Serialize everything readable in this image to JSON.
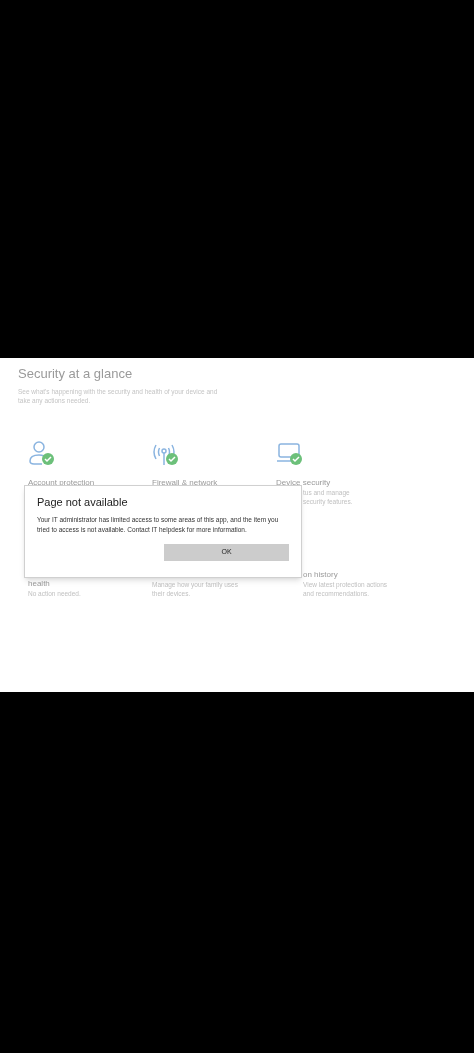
{
  "page": {
    "title": "Security at a glance",
    "subtitle": "See what's happening with the security and health of your device and take any actions needed."
  },
  "tiles": [
    {
      "kind": "person",
      "title": "Account protection"
    },
    {
      "kind": "antenna",
      "title": "Firewall & network"
    },
    {
      "kind": "laptop",
      "title": "Device security",
      "description_lines": [
        "tus and manage",
        "security features."
      ]
    }
  ],
  "tiles_row_2": [
    {
      "title": "health",
      "description_lines": [
        "No action needed."
      ]
    },
    {
      "description_lines": [
        "Manage how your family uses",
        "their devices."
      ]
    },
    {
      "title": "on history",
      "description_lines": [
        "View latest protection actions",
        "and recommendations."
      ]
    }
  ],
  "dialog": {
    "title": "Page not available",
    "message": "Your IT administrator has limited access to some areas of this app, and the item you tried to access is not available. Contact IT helpdesk for more information.",
    "button": "OK"
  }
}
